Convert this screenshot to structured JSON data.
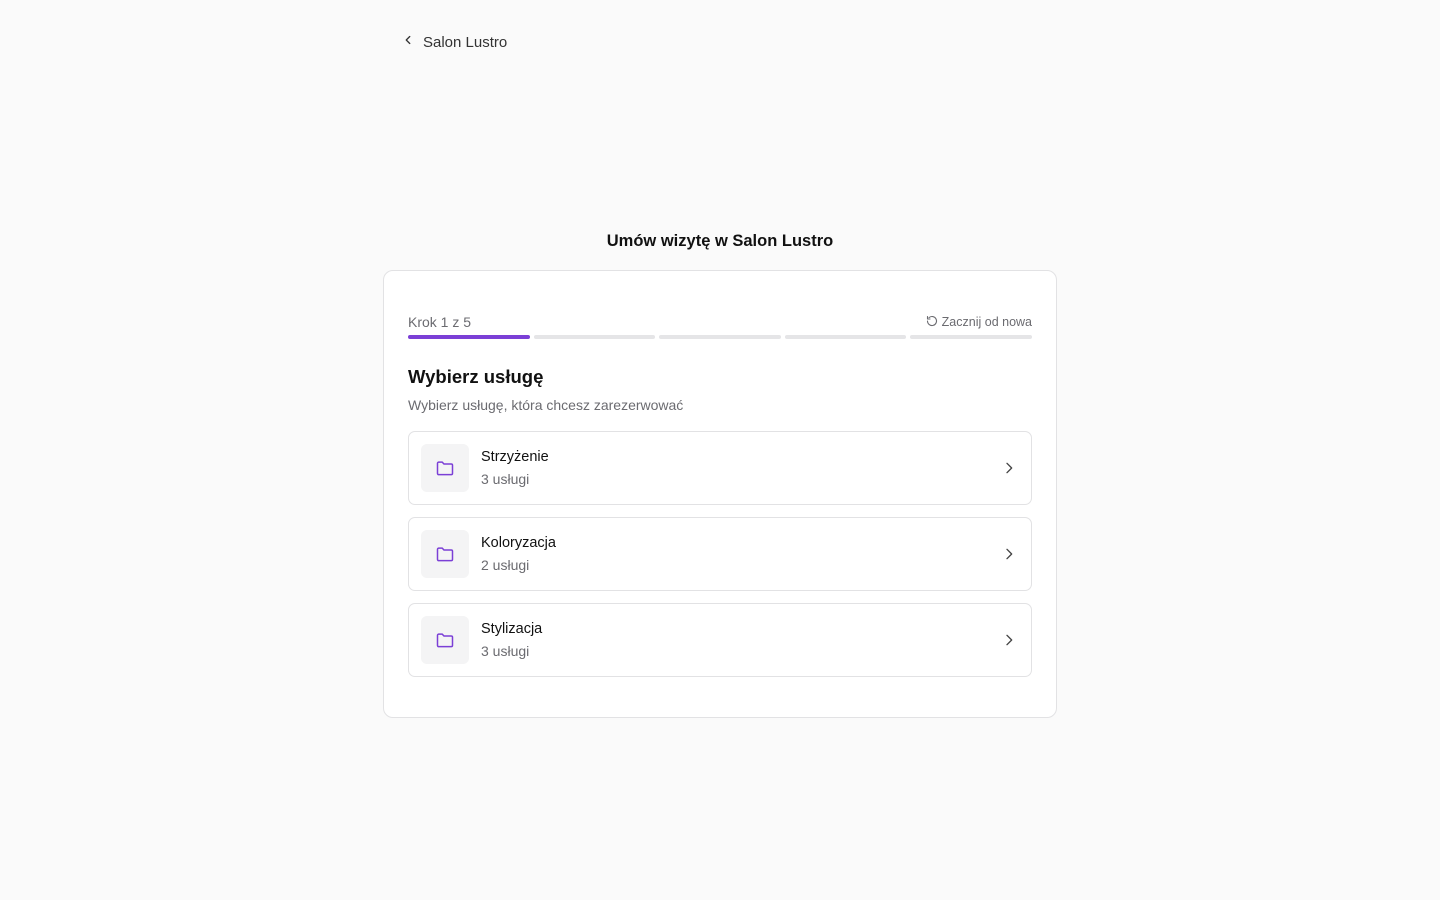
{
  "nav": {
    "back_label": "Salon Lustro"
  },
  "page": {
    "title": "Umów wizytę w Salon Lustro"
  },
  "wizard": {
    "step_label": "Krok 1 z 5",
    "restart_label": "Zacznij od nowa",
    "progress": {
      "current_step": 1,
      "total_steps": 5
    }
  },
  "section": {
    "title": "Wybierz usługę",
    "subtitle": "Wybierz usługę, która chcesz zarezerwować"
  },
  "categories": [
    {
      "name": "Strzyżenie",
      "count": "3 usługi",
      "icon": "folder-icon"
    },
    {
      "name": "Koloryzacja",
      "count": "2 usługi",
      "icon": "folder-icon"
    },
    {
      "name": "Stylizacja",
      "count": "3 usługi",
      "icon": "folder-icon"
    }
  ],
  "colors": {
    "accent": "#7b3fd6",
    "background": "#fafafa",
    "card": "#ffffff",
    "muted_text": "#6b6b70",
    "progress_inactive": "#e5e5e7"
  }
}
